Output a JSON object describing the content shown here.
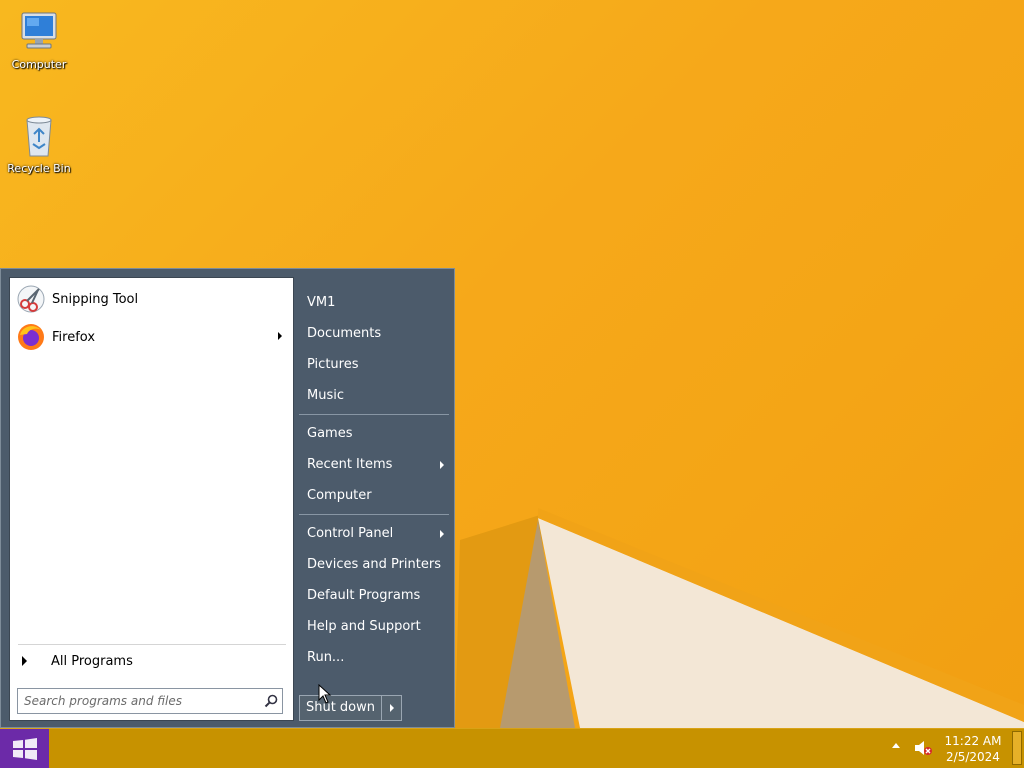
{
  "desktop": {
    "icons": [
      {
        "label": "Computer",
        "icon": "computer-icon"
      },
      {
        "label": "Recycle Bin",
        "icon": "recycle-bin-icon"
      }
    ]
  },
  "start_menu": {
    "programs": [
      {
        "label": "Snipping Tool",
        "icon": "snipping-tool-icon",
        "submenu": false
      },
      {
        "label": "Firefox",
        "icon": "firefox-icon",
        "submenu": true
      }
    ],
    "all_programs_label": "All Programs",
    "search": {
      "placeholder": "Search programs and files",
      "icon": "search-icon"
    },
    "places": [
      {
        "label": "VM1",
        "submenu": false
      },
      {
        "label": "Documents",
        "submenu": false
      },
      {
        "label": "Pictures",
        "submenu": false
      },
      {
        "label": "Music",
        "submenu": false
      },
      {
        "label": "Games",
        "submenu": false
      },
      {
        "label": "Recent Items",
        "submenu": true
      },
      {
        "label": "Computer",
        "submenu": false
      },
      {
        "label": "Control Panel",
        "submenu": true
      },
      {
        "label": "Devices and Printers",
        "submenu": false
      },
      {
        "label": "Default Programs",
        "submenu": false
      },
      {
        "label": "Help and Support",
        "submenu": false
      },
      {
        "label": "Run...",
        "submenu": false
      }
    ],
    "shutdown_label": "Shut down"
  },
  "taskbar": {
    "time": "11:22 AM",
    "date": "2/5/2024",
    "volume_icon": "volume-muted-icon"
  },
  "colors": {
    "desktop": "#f7b21c",
    "taskbar": "#c79200",
    "start_menu_right": "#4c5b6b",
    "start_button": "#6c2aa8"
  }
}
